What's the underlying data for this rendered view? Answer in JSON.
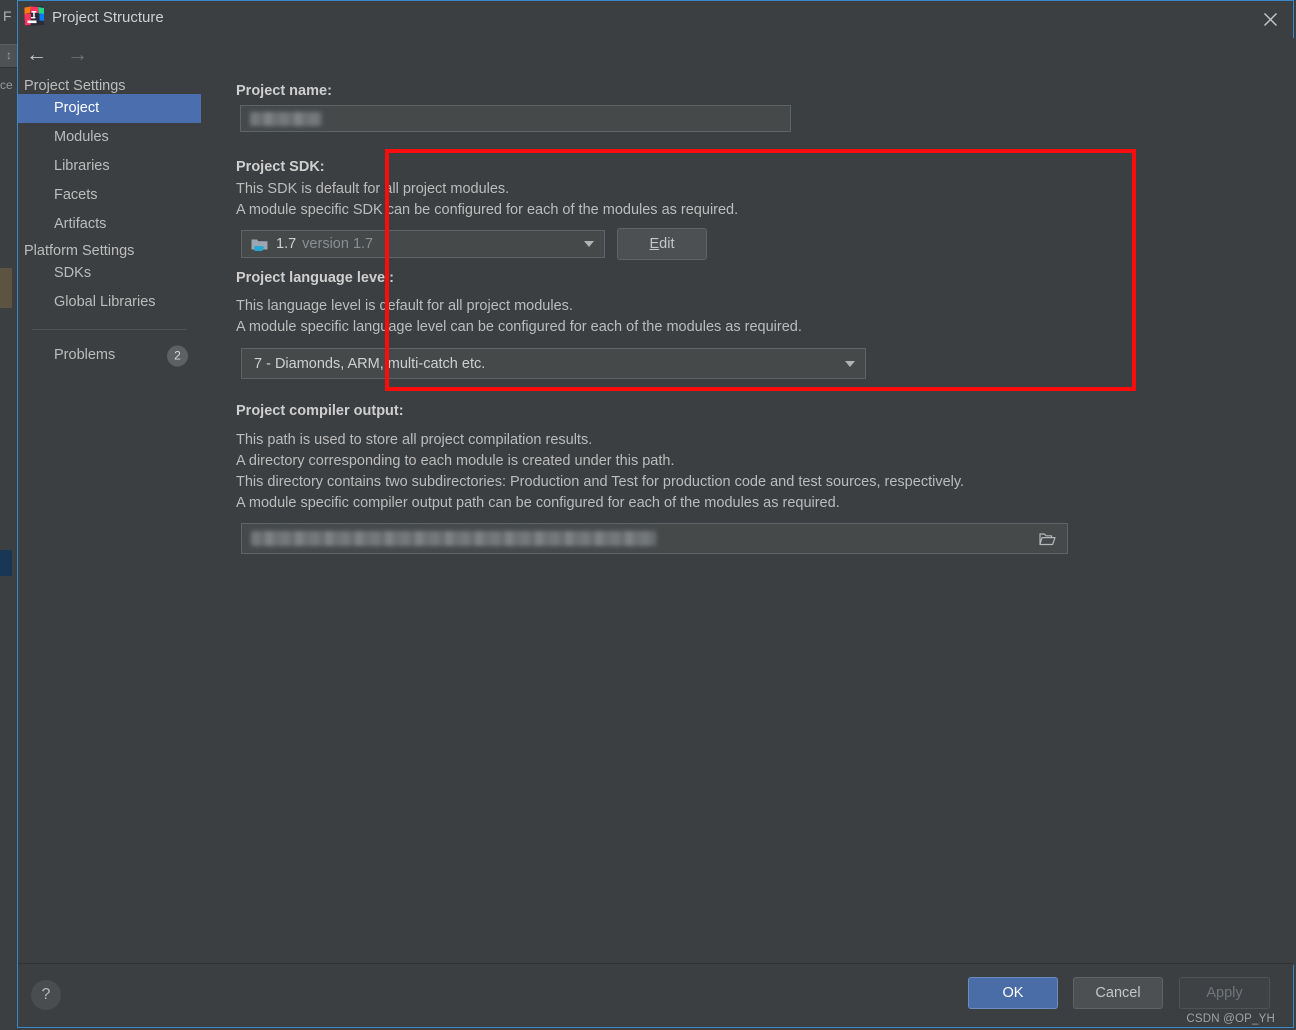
{
  "background": {
    "menu_letter": "F",
    "tab_label": "ce",
    "toolbar_icon": "updown-spinner-icon"
  },
  "window": {
    "title": "Project Structure",
    "app_icon": "intellij-idea-logo-icon",
    "close_icon": "close-icon"
  },
  "sidebar": {
    "nav": {
      "back_icon": "arrow-left-icon",
      "forward_icon": "arrow-right-icon"
    },
    "groups": [
      {
        "label": "Project Settings",
        "items": [
          {
            "label": "Project",
            "selected": true
          },
          {
            "label": "Modules",
            "selected": false
          },
          {
            "label": "Libraries",
            "selected": false
          },
          {
            "label": "Facets",
            "selected": false
          },
          {
            "label": "Artifacts",
            "selected": false
          }
        ]
      },
      {
        "label": "Platform Settings",
        "items": [
          {
            "label": "SDKs",
            "selected": false
          },
          {
            "label": "Global Libraries",
            "selected": false
          }
        ]
      }
    ],
    "problems": {
      "label": "Problems",
      "badge": "2"
    }
  },
  "main": {
    "project_name": {
      "label": "Project name:",
      "value": "",
      "redacted": true
    },
    "project_sdk": {
      "label": "Project SDK:",
      "desc_1": "This SDK is default for all project modules.",
      "desc_2": "A module specific SDK can be configured for each of the modules as required.",
      "combo": {
        "icon": "java-sdk-folder-icon",
        "value": "1.7",
        "value_sub": "version 1.7",
        "arrow_icon": "chevron-down-icon"
      },
      "edit_button": {
        "mnemonic": "E",
        "rest": "dit"
      }
    },
    "project_language_level": {
      "label": "Project language level:",
      "desc_1": "This language level is default for all project modules.",
      "desc_2": "A module specific language level can be configured for each of the modules as required.",
      "combo": {
        "value": "7 - Diamonds, ARM, multi-catch etc.",
        "arrow_icon": "chevron-down-icon"
      }
    },
    "project_compiler_output": {
      "label": "Project compiler output:",
      "desc_1": "This path is used to store all project compilation results.",
      "desc_2": "A directory corresponding to each module is created under this path.",
      "desc_3": "This directory contains two subdirectories: Production and Test for production code and test sources, respectively.",
      "desc_4": "A module specific compiler output path can be configured for each of the modules as required.",
      "field": {
        "value": "",
        "redacted": true,
        "browse_icon": "folder-open-icon"
      }
    }
  },
  "highlight": {
    "color": "#fb0d0d",
    "name": "sdk-section-highlight"
  },
  "footer": {
    "help_label": "?",
    "ok_label": "OK",
    "cancel_label": "Cancel",
    "apply_label": "Apply",
    "apply_enabled": false
  },
  "watermark": {
    "text": "CSDN @OP_YH"
  }
}
